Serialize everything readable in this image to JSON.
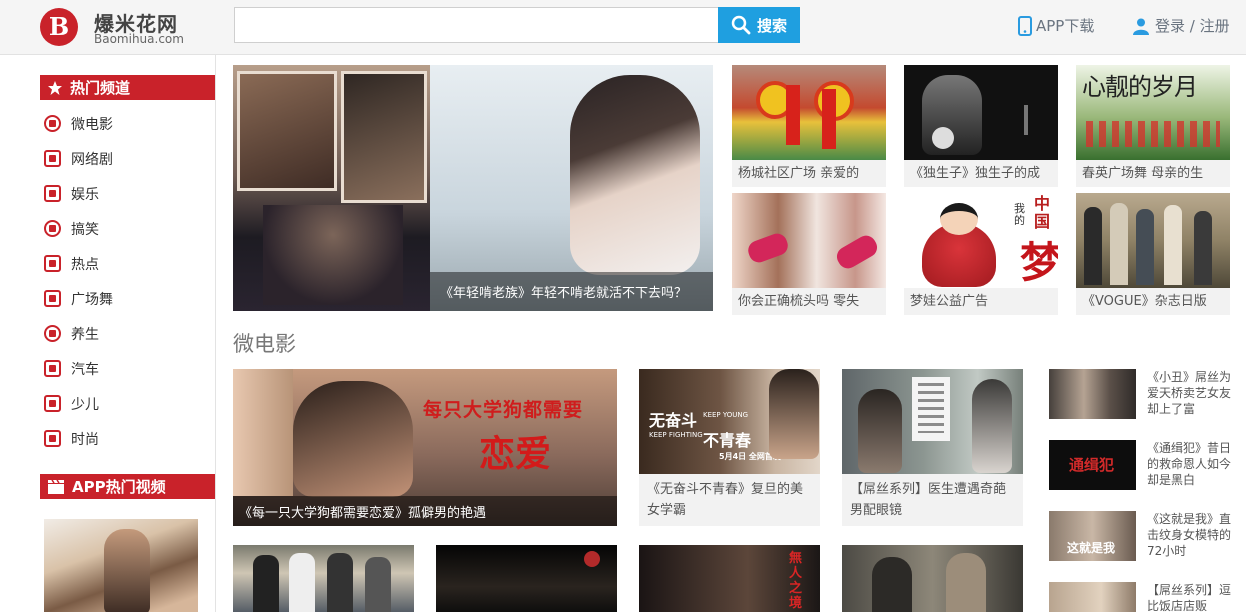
{
  "brand": {
    "logo_cn": "爆米花网",
    "logo_en": "Baomihua.com",
    "logo_letter": "B"
  },
  "header": {
    "search_placeholder": "",
    "search_button": "搜索",
    "app_download": "APP下载",
    "login": "登录 / 注册"
  },
  "sidebar": {
    "hot_channels_title": "热门频道",
    "items": [
      {
        "label": "微电影",
        "icon": "film-reel-icon"
      },
      {
        "label": "网络剧",
        "icon": "tv-icon"
      },
      {
        "label": "娱乐",
        "icon": "film-strip-icon"
      },
      {
        "label": "搞笑",
        "icon": "smiley-icon"
      },
      {
        "label": "热点",
        "icon": "newspaper-icon"
      },
      {
        "label": "广场舞",
        "icon": "dancer-icon"
      },
      {
        "label": "养生",
        "icon": "cloche-icon"
      },
      {
        "label": "汽车",
        "icon": "car-icon"
      },
      {
        "label": "少儿",
        "icon": "book-icon"
      },
      {
        "label": "时尚",
        "icon": "cocktail-icon"
      }
    ],
    "app_hot_title": "APP热门视频"
  },
  "hero": {
    "caption": "《年轻啃老族》年轻不啃老就活不下去吗？"
  },
  "top_grid": [
    {
      "caption": "杨城社区广场 亲爱的"
    },
    {
      "caption": "《独生子》独生子的成"
    },
    {
      "caption": "春英广场舞 母亲的生"
    },
    {
      "caption": "你会正确梳头吗 零失"
    },
    {
      "caption": "梦娃公益广告"
    },
    {
      "caption": "《VOGUE》杂志日版"
    }
  ],
  "thumb_texts": {
    "top3": "心靓的岁月",
    "mid2_a": "中国",
    "mid2_b": "我的",
    "mid2_c": "梦",
    "mid2_stamp": "我的"
  },
  "section": {
    "title": "微电影"
  },
  "featured": {
    "overlay_line1": "每只大学狗都需要",
    "overlay_line2": "恋爱",
    "caption": "《每一只大学狗都需要恋爱》孤僻男的艳遇"
  },
  "mid_cards": [
    {
      "caption": "《无奋斗不青春》复旦的美女学霸",
      "overlay_line1": "无奋斗",
      "overlay_line2": "不青春",
      "overlay_en1": "KEEP YOUNG",
      "overlay_en2": "KEEP FIGHTING",
      "overlay_date": "5月4日 全网首发"
    },
    {
      "caption": "【屌丝系列】医生遭遇奇葩男配眼镜"
    }
  ],
  "side_list": [
    {
      "text": "《小丑》屌丝为爱天桥卖艺女友却上了富"
    },
    {
      "text": "《通缉犯》昔日的救命恩人如今却是黑白",
      "overlay": "通缉犯"
    },
    {
      "text": "《这就是我》直击纹身女模特的72小时",
      "overlay": "这就是我"
    },
    {
      "text": "【屌丝系列】逗比饭店店贩"
    }
  ],
  "row3_overlays": {
    "third": "無人之境"
  },
  "colors": {
    "brand_red": "#c9222a",
    "search_blue": "#1f9fe0"
  }
}
